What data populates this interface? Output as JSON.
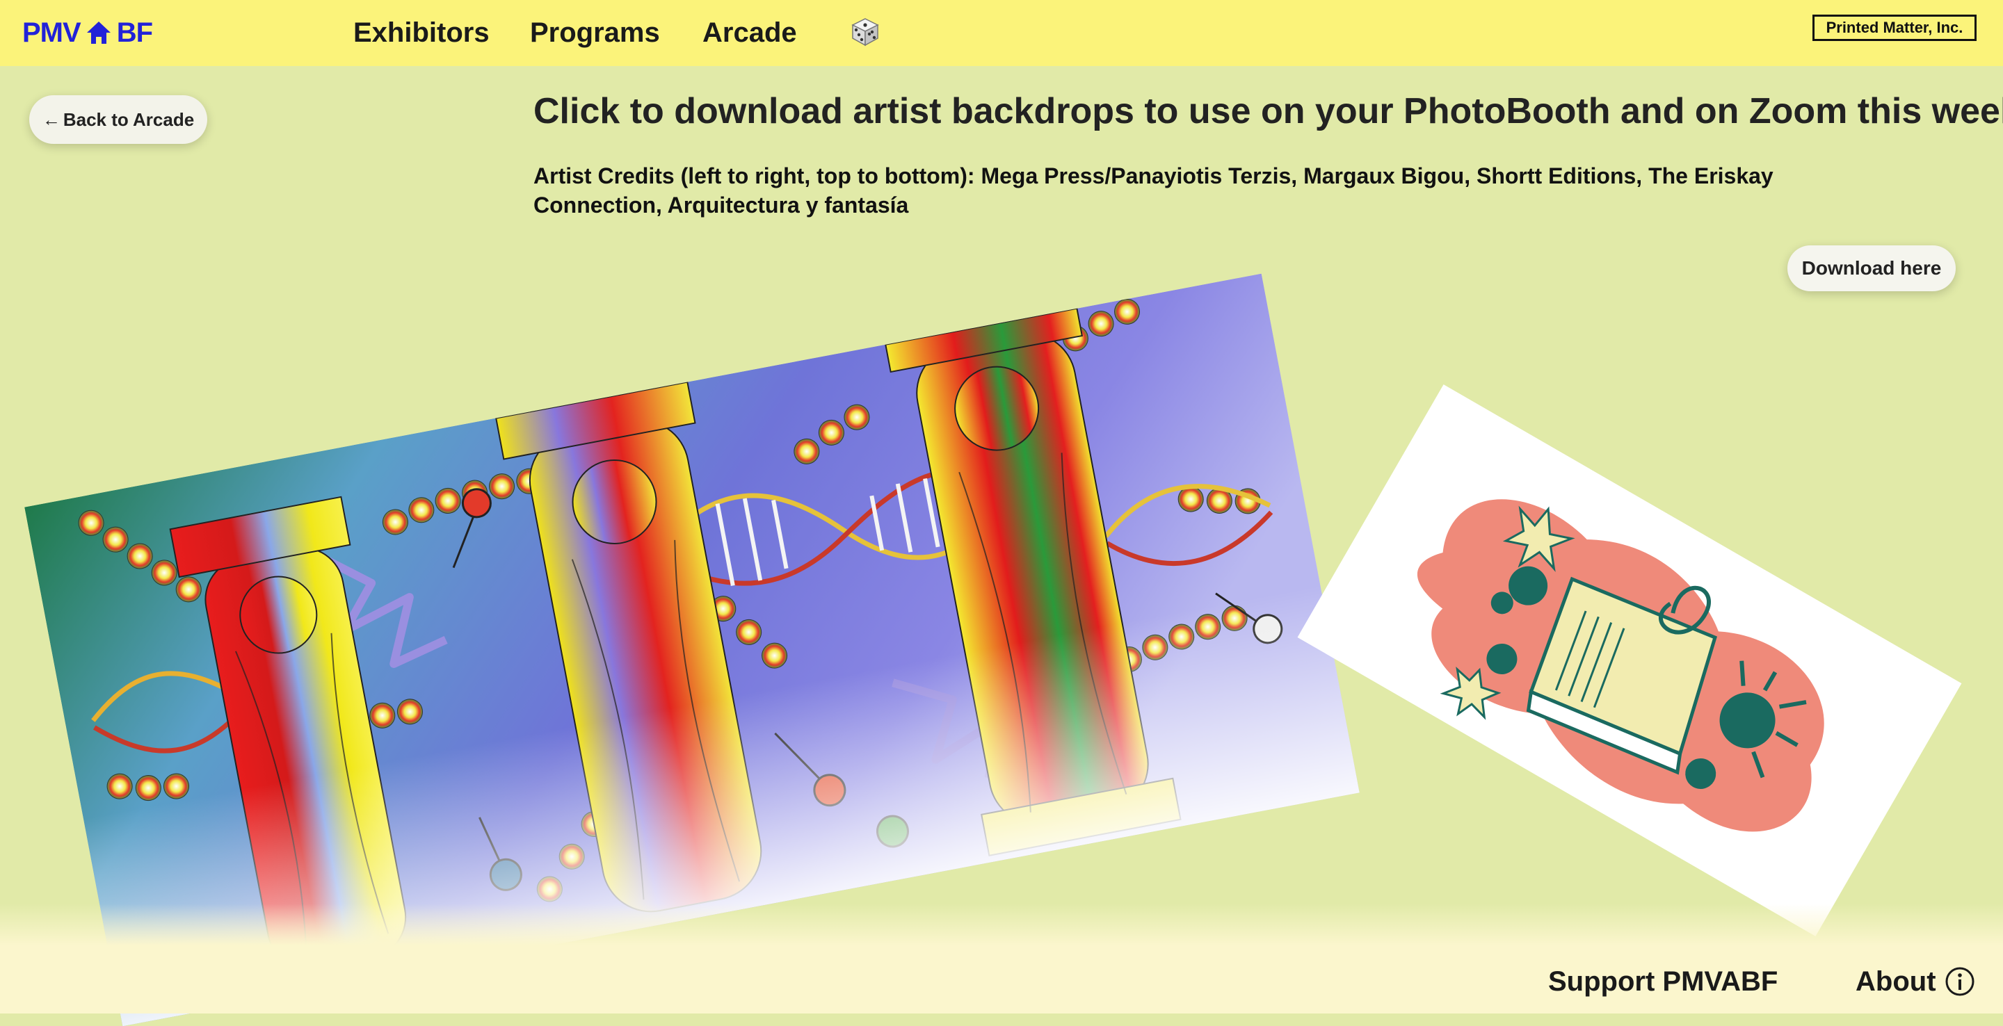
{
  "header": {
    "logo": {
      "left": "PMV",
      "icon": "house-icon",
      "right": "BF",
      "color": "#2222d8"
    },
    "nav": [
      {
        "label": "Exhibitors"
      },
      {
        "label": "Programs"
      },
      {
        "label": "Arcade"
      }
    ],
    "dice_icon": "dice-icon",
    "badge": "Printed Matter, Inc."
  },
  "back_button": {
    "arrow": "←",
    "label": "Back to Arcade"
  },
  "main": {
    "headline": "Click to download artist backdrops to use on your PhotoBooth and on Zoom this week.",
    "credits": "Artist Credits (left to right, top to bottom):  Mega Press/Panayiotis Terzis, Margaux Bigou, Shortt Editions, The Eriskay Connection, Arquitectura y fantasía",
    "download_label": "Download here"
  },
  "footer": {
    "support_label": "Support PMVABF",
    "about_label": "About",
    "info_icon": "info-icon"
  },
  "colors": {
    "background": "#e1eaa8",
    "topbar": "#fbf37a",
    "footer": "#fbf6cd",
    "accent_blue": "#2222d8"
  }
}
